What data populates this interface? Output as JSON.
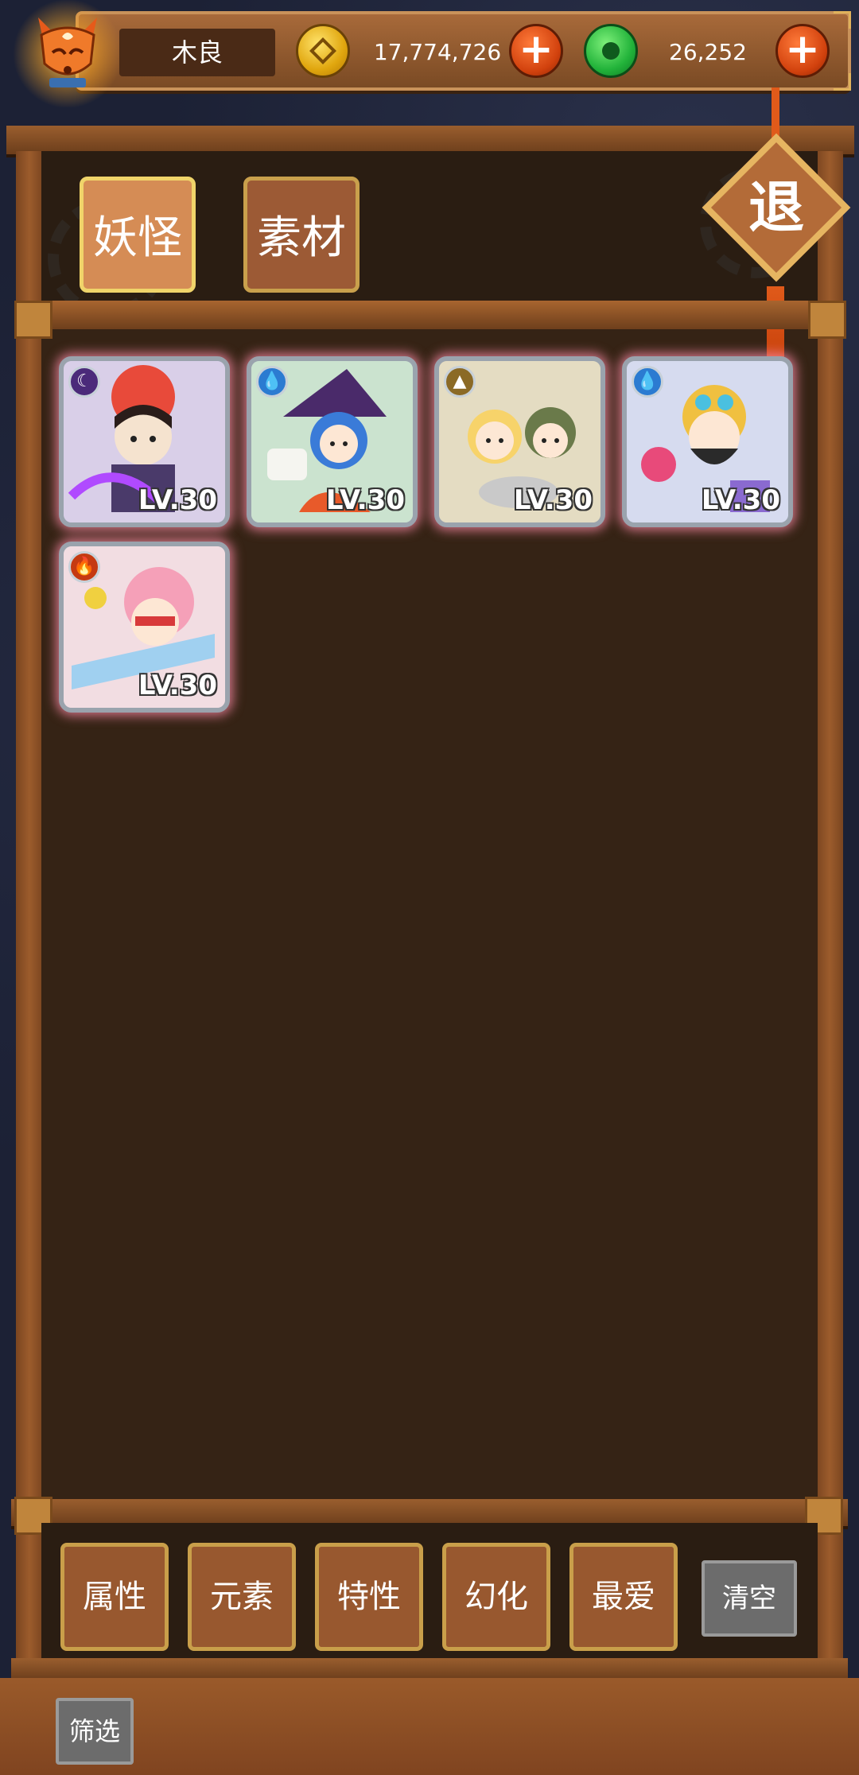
{
  "player": {
    "name": "木良",
    "avatar_icon": "fox-mask-avatar-icon"
  },
  "currencies": [
    {
      "icon": "gold-coin-icon",
      "value": "17,774,726",
      "color": "#f0c030"
    },
    {
      "icon": "jade-coin-icon",
      "value": "26,252",
      "color": "#2cc24a"
    }
  ],
  "tabs": [
    {
      "label": "妖怪",
      "active": true
    },
    {
      "label": "素材",
      "active": false
    }
  ],
  "retreat_button": {
    "label": "退"
  },
  "monsters": [
    {
      "level": "LV.30",
      "element_icon": "moon-element-icon",
      "element_color": "#4b2a7a"
    },
    {
      "level": "LV.30",
      "element_icon": "water-drop-element-icon",
      "element_color": "#2b7bd1"
    },
    {
      "level": "LV.30",
      "element_icon": "earth-element-icon",
      "element_color": "#8b6a26"
    },
    {
      "level": "LV.30",
      "element_icon": "water-drop-element-icon",
      "element_color": "#2b7bd1"
    },
    {
      "level": "LV.30",
      "element_icon": "fire-element-icon",
      "element_color": "#c53a12"
    }
  ],
  "filters": [
    {
      "label": "属性"
    },
    {
      "label": "元素"
    },
    {
      "label": "特性"
    },
    {
      "label": "幻化"
    },
    {
      "label": "最爱"
    }
  ],
  "clear_button": {
    "label": "清空"
  },
  "filter_toggle": {
    "label": "筛选"
  },
  "colors": {
    "wood": "#8a4f25",
    "board": "#352315",
    "card_glow": "#ff8caa",
    "accent_orange": "#d1410d"
  }
}
